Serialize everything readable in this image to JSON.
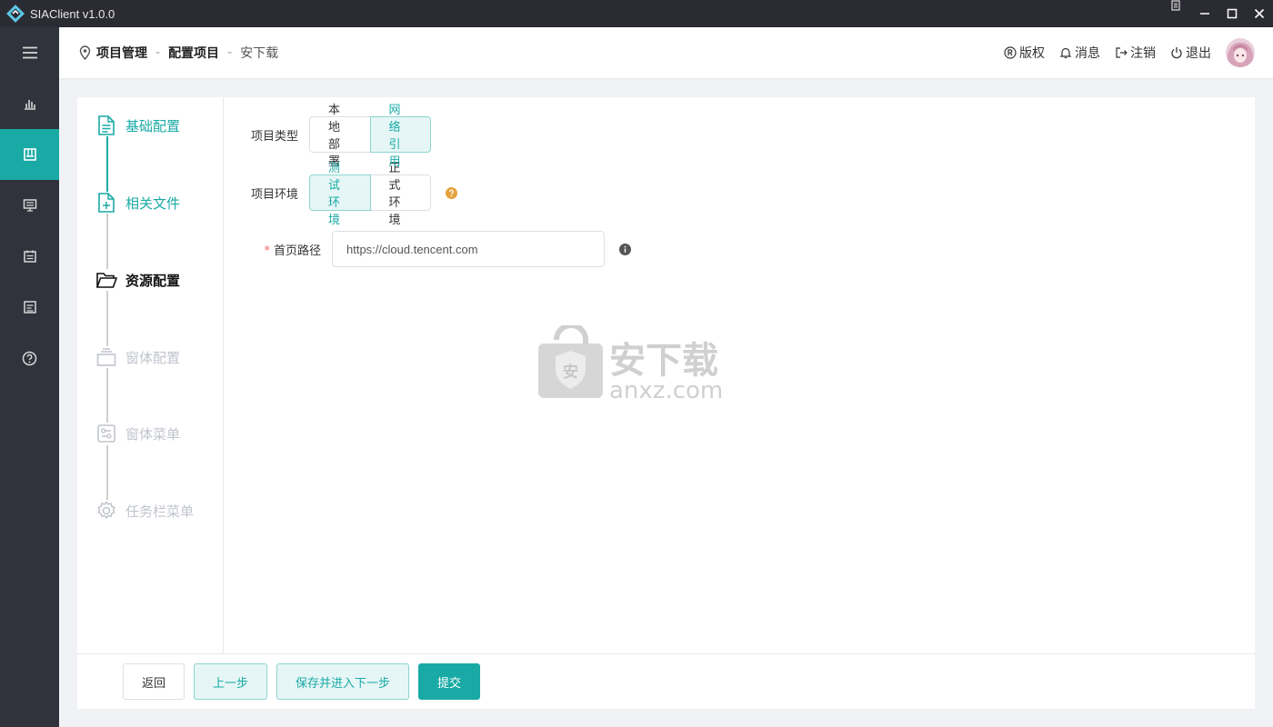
{
  "window": {
    "title": "SIAClient v1.0.0"
  },
  "colors": {
    "accent": "#19aaa5",
    "sidebar": "#30323c",
    "titlebar": "#2b2b33",
    "disabled": "#c0c4cc"
  },
  "sidebar": {
    "items": [
      {
        "icon": "menu-icon"
      },
      {
        "icon": "bar-chart-icon"
      },
      {
        "icon": "project-icon",
        "active": true
      },
      {
        "icon": "monitor-icon"
      },
      {
        "icon": "calendar-icon"
      },
      {
        "icon": "document-icon"
      },
      {
        "icon": "help-icon"
      }
    ]
  },
  "breadcrumb": {
    "items": [
      "项目管理",
      "配置项目",
      "安下载"
    ],
    "separator": "-"
  },
  "header_actions": {
    "copyright": "版权",
    "messages": "消息",
    "logout": "注销",
    "exit": "退出"
  },
  "steps": [
    {
      "label": "基础配置",
      "state": "done",
      "icon": "file-text-icon"
    },
    {
      "label": "相关文件",
      "state": "done",
      "icon": "file-plus-icon"
    },
    {
      "label": "资源配置",
      "state": "active",
      "icon": "folder-open-icon"
    },
    {
      "label": "窗体配置",
      "state": "pending",
      "icon": "window-icon"
    },
    {
      "label": "窗体菜单",
      "state": "pending",
      "icon": "menu-settings-icon"
    },
    {
      "label": "任务栏菜单",
      "state": "pending",
      "icon": "gear-icon"
    }
  ],
  "form": {
    "project_type": {
      "label": "项目类型",
      "options": [
        "本地部署",
        "网络引用"
      ],
      "selected": "网络引用"
    },
    "project_env": {
      "label": "项目环境",
      "options": [
        "测试环境",
        "正式环境"
      ],
      "selected": "测试环境"
    },
    "home_path": {
      "label": "首页路径",
      "required_mark": "*",
      "value": "https://cloud.tencent.com"
    }
  },
  "watermark": {
    "cn": "安下载",
    "en": "anxz.com",
    "badge": "安"
  },
  "footer": {
    "back": "返回",
    "prev": "上一步",
    "save_next": "保存并进入下一步",
    "submit": "提交"
  }
}
